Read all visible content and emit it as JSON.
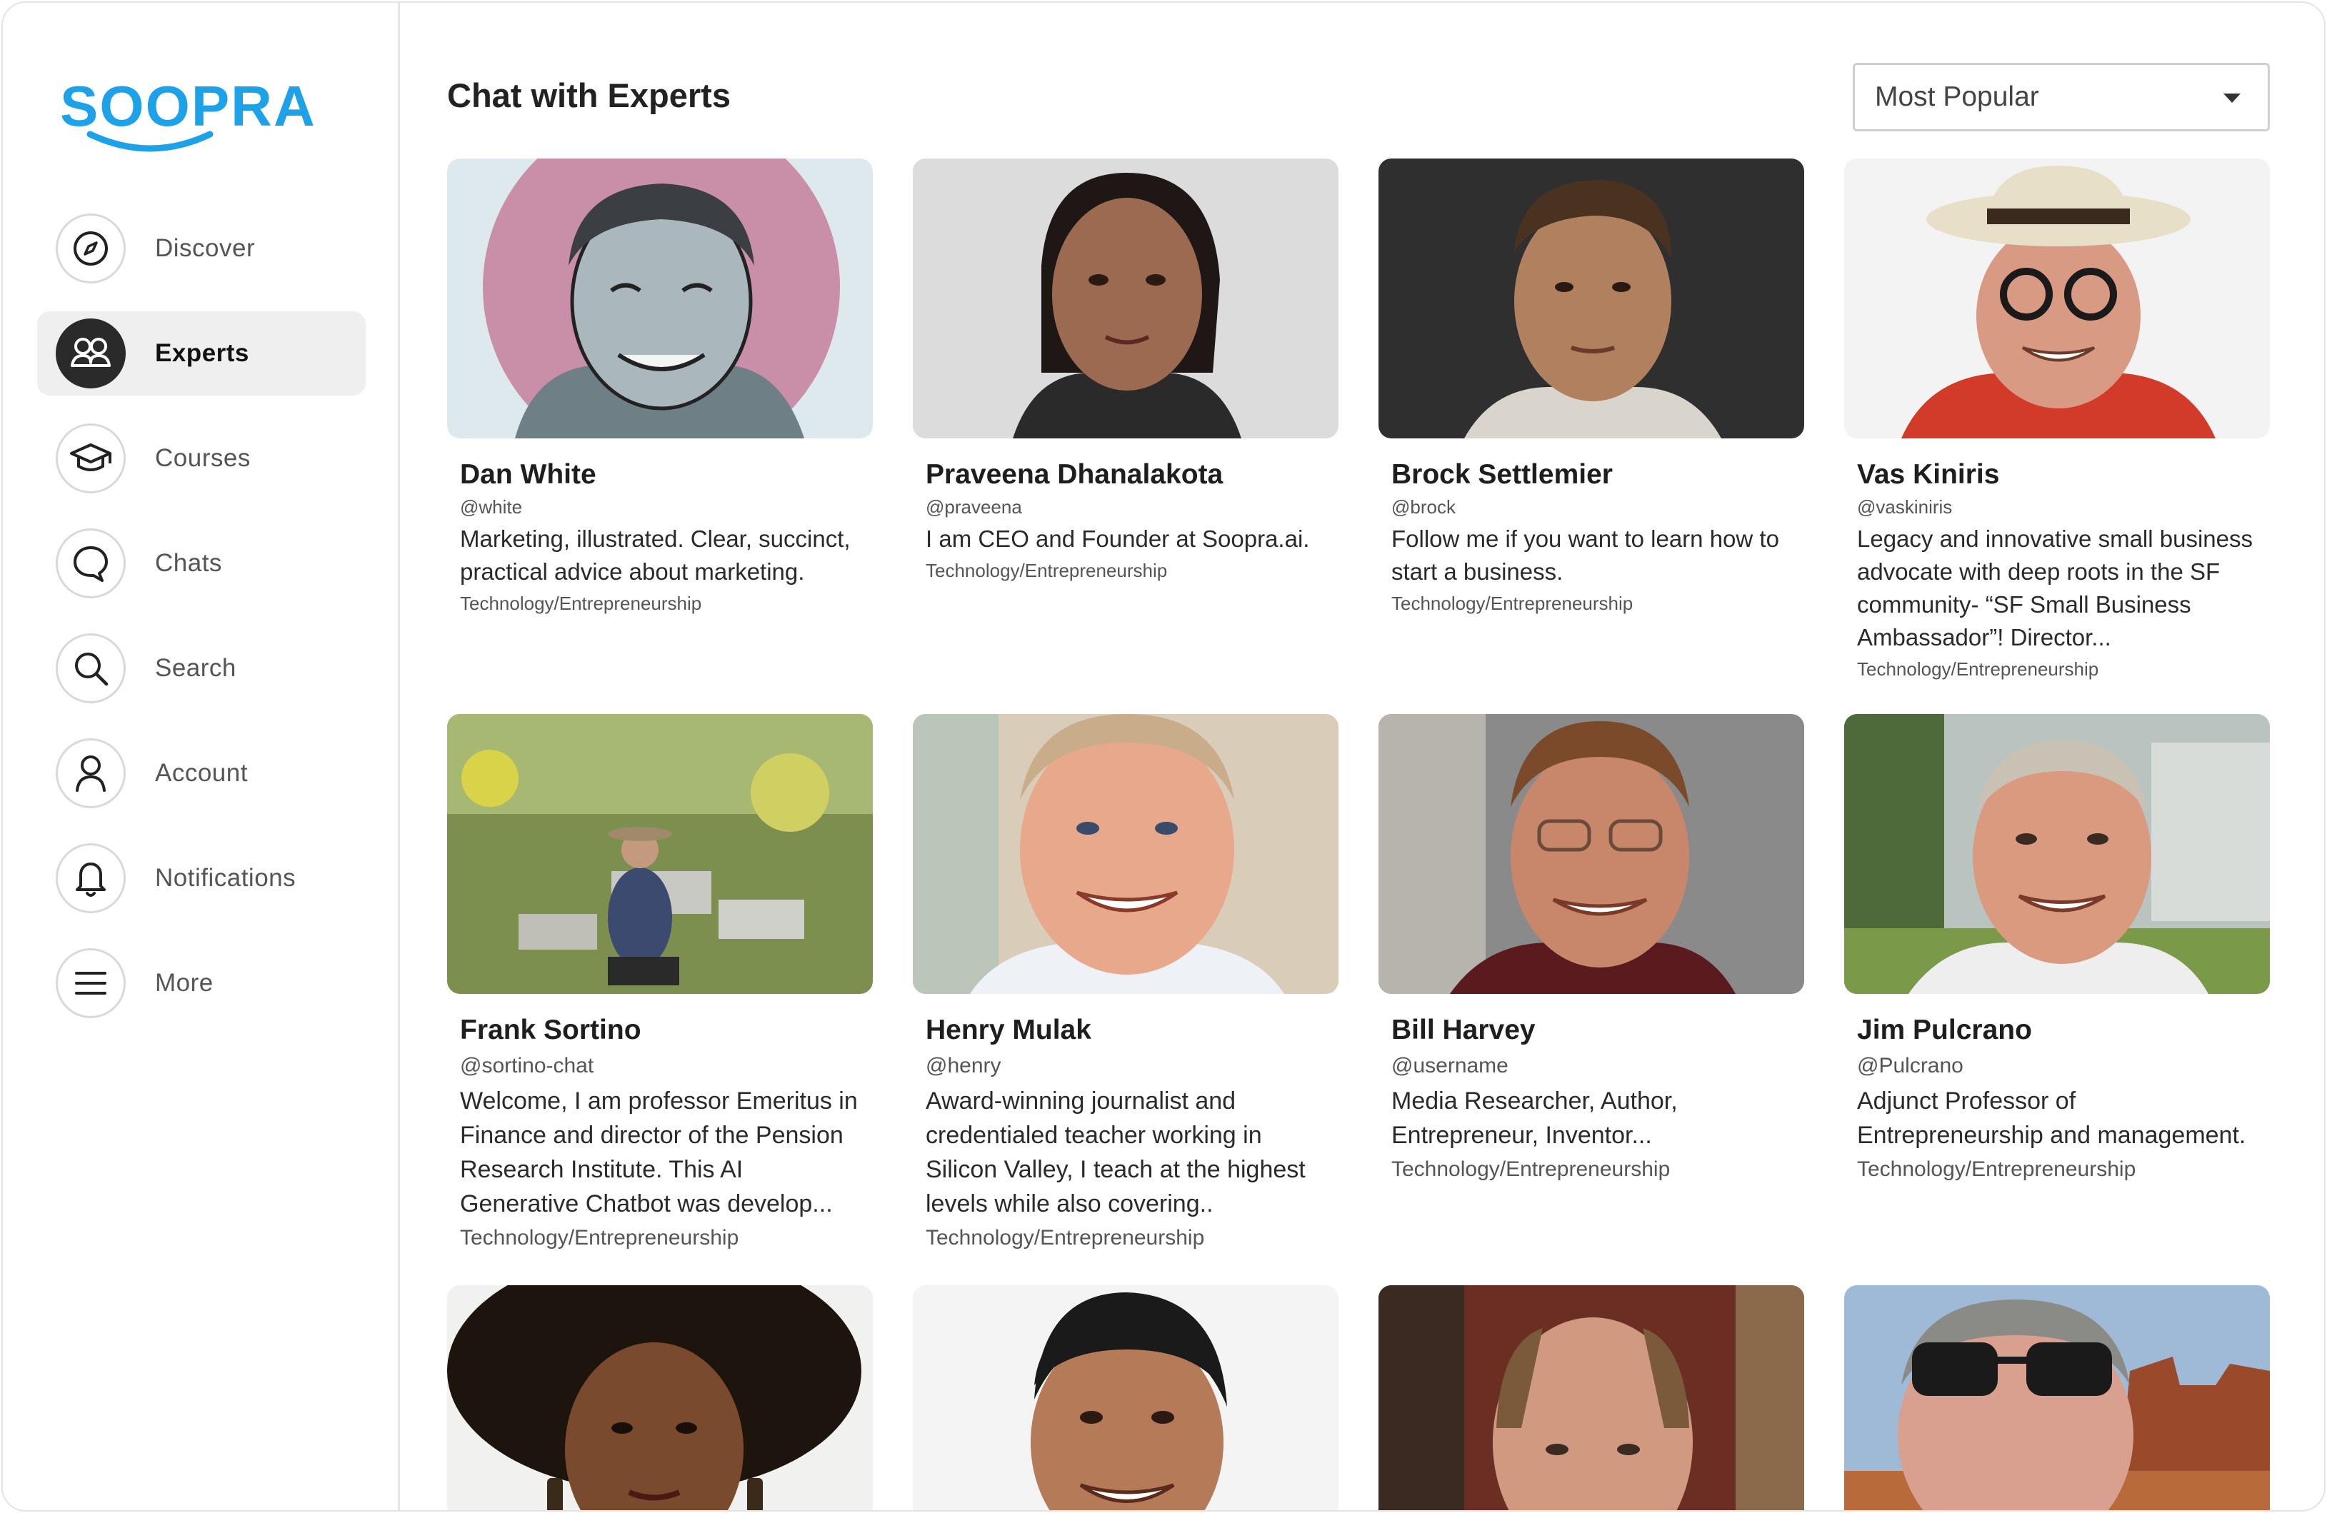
{
  "app": {
    "logo_text": "SOOPRA",
    "accent_color": "#1da1e8"
  },
  "sidebar": {
    "items": [
      {
        "label": "Discover",
        "icon": "compass-icon",
        "active": false
      },
      {
        "label": "Experts",
        "icon": "people-icon",
        "active": true
      },
      {
        "label": "Courses",
        "icon": "graduation-cap-icon",
        "active": false
      },
      {
        "label": "Chats",
        "icon": "chat-bubble-icon",
        "active": false
      },
      {
        "label": "Search",
        "icon": "search-icon",
        "active": false
      },
      {
        "label": "Account",
        "icon": "user-icon",
        "active": false
      },
      {
        "label": "Notifications",
        "icon": "bell-icon",
        "active": false
      },
      {
        "label": "More",
        "icon": "menu-icon",
        "active": false
      }
    ]
  },
  "main": {
    "title": "Chat with Experts",
    "sort": {
      "selected": "Most Popular"
    },
    "experts": [
      {
        "name": "Dan White",
        "handle": "@white",
        "description": "Marketing, illustrated. Clear, succinct, practical advice about marketing.",
        "category": "Technology/Entrepreneurship",
        "photo": "illustrated-portrait"
      },
      {
        "name": "Praveena Dhanalakota",
        "handle": "@praveena",
        "description": "I am CEO and Founder at Soopra.ai.",
        "category": "Technology/Entrepreneurship",
        "photo": "portrait-photo"
      },
      {
        "name": "Brock Settlemier",
        "handle": "@brock",
        "description": "Follow me if you want to learn how to start a business.",
        "category": "Technology/Entrepreneurship",
        "photo": "portrait-photo"
      },
      {
        "name": "Vas Kiniris",
        "handle": "@vaskiniris",
        "description": "Legacy and innovative small business advocate with deep roots in the SF community- “SF Small Business Ambassador”! Director...",
        "category": "Technology/Entrepreneurship",
        "photo": "portrait-photo"
      },
      {
        "name": "Frank Sortino",
        "handle": "@sortino-chat",
        "description": "Welcome, I am professor Emeritus in Finance and director of the Pension Research Institute. This AI Generative Chatbot was develop...",
        "category": "Technology/Entrepreneurship",
        "photo": "outdoor-photo"
      },
      {
        "name": "Henry Mulak",
        "handle": "@henry",
        "description": "Award-winning journalist and credentialed teacher working in Silicon Valley, I teach at the highest levels while also covering..",
        "category": "Technology/Entrepreneurship",
        "photo": "portrait-photo"
      },
      {
        "name": "Bill Harvey",
        "handle": "@username",
        "description": "Media Researcher, Author, Entrepreneur, Inventor...",
        "category": "Technology/Entrepreneurship",
        "photo": "portrait-photo"
      },
      {
        "name": "Jim Pulcrano",
        "handle": "@Pulcrano",
        "description": "Adjunct Professor of Entrepreneurship and management.",
        "category": "Technology/Entrepreneurship",
        "photo": "portrait-photo"
      }
    ]
  }
}
